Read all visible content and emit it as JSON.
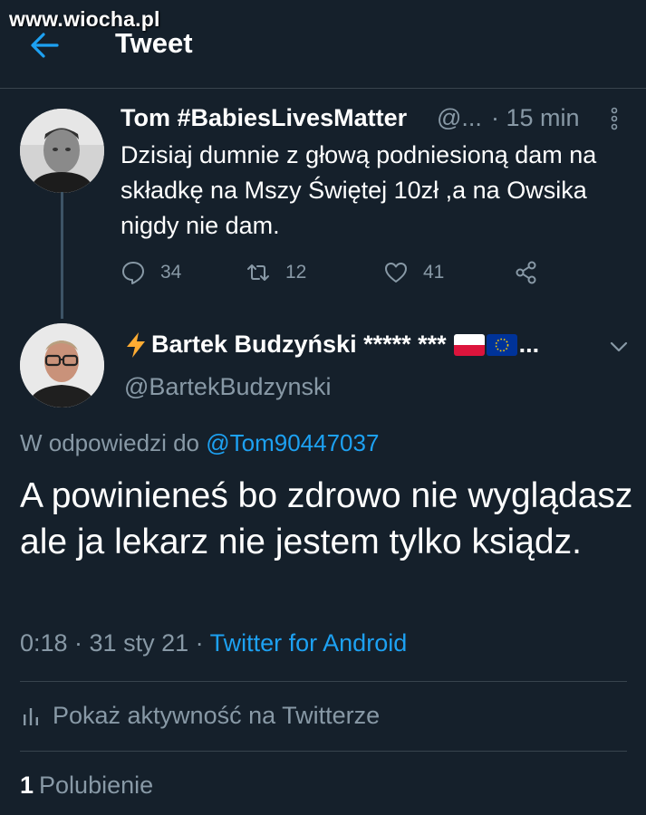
{
  "watermark": "www.wiocha.pl",
  "header": {
    "title": "Tweet",
    "back_icon": "arrow-left-icon",
    "accent": "#1da1f2"
  },
  "parent_tweet": {
    "name": "Tom #BabiesLivesMatter",
    "handle": "@...",
    "time": "· 15 min",
    "text": "Dzisiaj dumnie z głową podniesioną dam na składkę na Mszy Świętej 10zł ,a na Owsika nigdy nie dam.",
    "replies": "34",
    "retweets": "12",
    "likes": "41"
  },
  "main_tweet": {
    "name": "Bartek Budzyński ***** ***",
    "name_overflow": "...",
    "handle": "@BartekBudzynski",
    "reply_prefix": "W odpowiedzi do",
    "reply_to": "@Tom90447037",
    "text": "A powinieneś bo zdrowo nie wyglądasz ale ja lekarz nie jestem tylko ksiądz.",
    "timestamp": "0:18 · 31 sty 21 ·",
    "source": "Twitter for Android"
  },
  "activity": {
    "label": "Pokaż aktywność na Twitterze"
  },
  "likes_row": {
    "count": "1",
    "label": "Polubienie"
  }
}
